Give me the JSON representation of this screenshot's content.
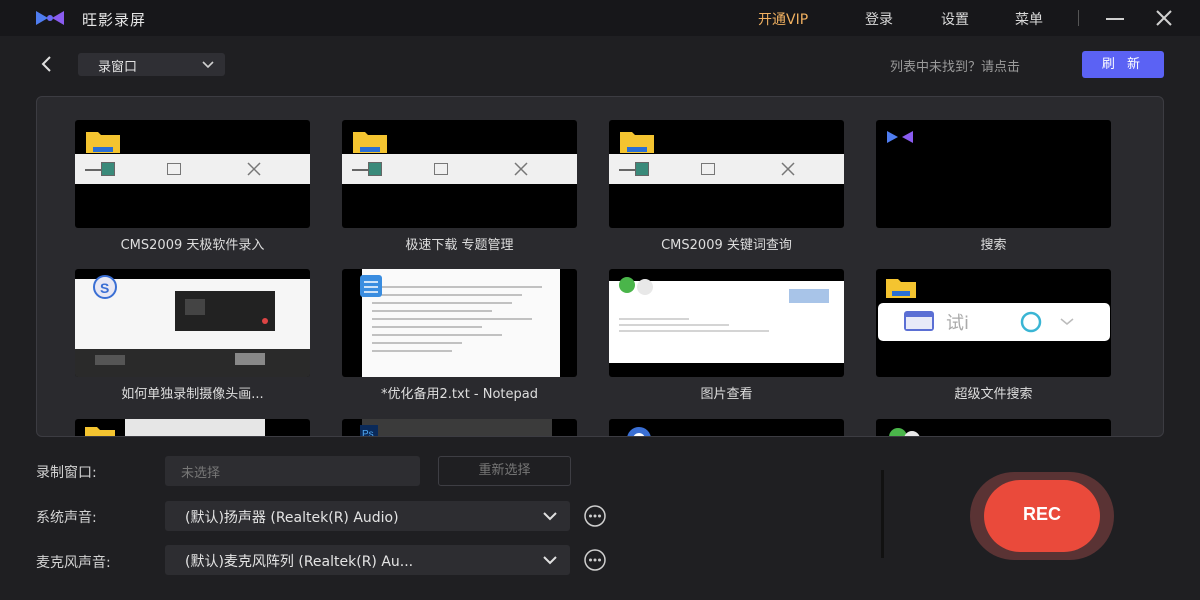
{
  "titlebar": {
    "app_title": "旺影录屏",
    "vip": "开通VIP",
    "login": "登录",
    "settings": "设置",
    "menu": "菜单"
  },
  "toolbar": {
    "mode": "录窗口",
    "hint": "列表中未找到？请点击",
    "refresh": "刷 新"
  },
  "windows": [
    {
      "label": "CMS2009 天极软件录入",
      "type": "folder-window"
    },
    {
      "label": "极速下载 专题管理",
      "type": "folder-window"
    },
    {
      "label": "CMS2009 关键词查询",
      "type": "folder-window"
    },
    {
      "label": "搜索",
      "type": "app-black"
    },
    {
      "label": "如何单独录制摄像头画...",
      "type": "browser"
    },
    {
      "label": "*优化备用2.txt - Notepad",
      "type": "notepad"
    },
    {
      "label": "图片查看",
      "type": "image-viewer"
    },
    {
      "label": "超级文件搜索",
      "type": "search-tool"
    }
  ],
  "controls": {
    "record_window_label": "录制窗口:",
    "record_window_placeholder": "未选择",
    "reselect": "重新选择",
    "system_audio_label": "系统声音:",
    "system_audio_value": "(默认)扬声器 (Realtek(R) Audio)",
    "mic_label": "麦克风声音:",
    "mic_value": "(默认)麦克风阵列 (Realtek(R) Au..."
  },
  "rec_button": "REC",
  "colors": {
    "accent": "#5b62f4",
    "rec": "#ea4a3b",
    "vip": "#f0b060",
    "background": "#1f1f22"
  }
}
